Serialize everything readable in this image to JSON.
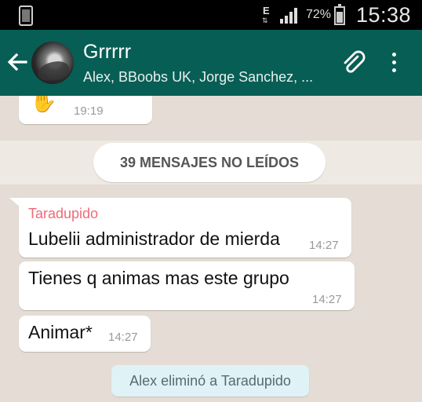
{
  "status_bar": {
    "network_type": "E",
    "battery_percent": "72%",
    "clock": "15:38"
  },
  "header": {
    "title": "Grrrrr",
    "members": "Alex, BBoobs UK, Jorge Sanchez, ..."
  },
  "messages": {
    "previous": {
      "emoji": "✋",
      "time": "19:19"
    },
    "unread_banner": "39 MENSAJES NO LEÍDOS",
    "items": [
      {
        "sender": "Taradupido",
        "text": "Lubelii administrador de mierda",
        "time": "14:27"
      },
      {
        "text": "Tienes q animas mas este grupo",
        "time": "14:27"
      },
      {
        "text": "Animar*",
        "time": "14:27"
      }
    ],
    "system_notice": "Alex eliminó a Taradupido"
  },
  "colors": {
    "header": "#075e54",
    "chat_background": "#e5ddd5",
    "sender_name": "#ef6a77",
    "system_notice_bg": "#dff3f6"
  }
}
